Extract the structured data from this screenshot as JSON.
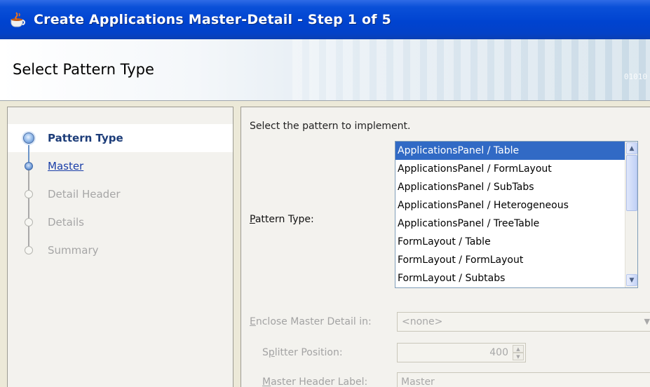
{
  "window": {
    "title": "Create Applications Master-Detail - Step 1 of 5",
    "icon": "coffee-cup-icon"
  },
  "header": {
    "page_title": "Select Pattern Type",
    "decoration_text": "01010"
  },
  "train": {
    "steps": [
      {
        "label": "Pattern Type",
        "state": "current"
      },
      {
        "label": "Master",
        "state": "visited"
      },
      {
        "label": "Detail Header",
        "state": "disabled"
      },
      {
        "label": "Details",
        "state": "disabled"
      },
      {
        "label": "Summary",
        "state": "disabled"
      }
    ]
  },
  "content": {
    "instruction": "Select the pattern to implement.",
    "pattern_type_label": {
      "mnemonic": "P",
      "rest": "attern Type:"
    },
    "pattern_list": [
      "ApplicationsPanel / Table",
      "ApplicationsPanel / FormLayout",
      "ApplicationsPanel / SubTabs",
      "ApplicationsPanel / Heterogeneous",
      "ApplicationsPanel / TreeTable",
      "FormLayout / Table",
      "FormLayout / FormLayout",
      "FormLayout / Subtabs"
    ],
    "selected_index": 0,
    "enclose_label": {
      "mnemonic": "E",
      "rest": "nclose Master Detail in:"
    },
    "enclose_value": "<none>",
    "splitter_label": {
      "pre": "S",
      "mnemonic": "p",
      "rest": "litter Position:"
    },
    "splitter_value": "400",
    "master_header_label": {
      "mnemonic": "M",
      "rest": "aster Header Label:"
    },
    "master_header_value": "Master"
  },
  "colors": {
    "titlebar": "#0043d0",
    "selection": "#316ac5",
    "train_current": "#1d3d79",
    "train_link": "#1a3ea8",
    "disabled_text": "#a6a6a6"
  }
}
